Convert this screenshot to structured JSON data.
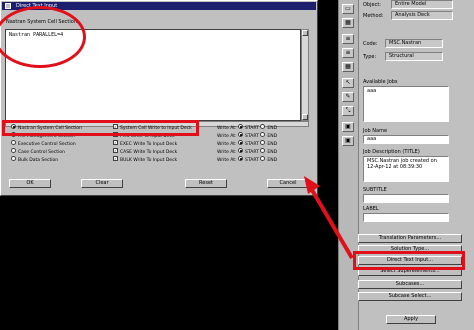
{
  "dialog": {
    "title": "Direct Text Input",
    "section_label": "Nastran System Cell Section",
    "text_content": "Nastran PARALLEL=4",
    "options_left": [
      {
        "label": "Nastran System Cell Section",
        "selected": true
      },
      {
        "label": "File Management Section",
        "selected": false
      },
      {
        "label": "Executive Control Section",
        "selected": false
      },
      {
        "label": "Case Control Section",
        "selected": false
      },
      {
        "label": "Bulk Data Section",
        "selected": false
      }
    ],
    "options_mid": [
      {
        "label": "System Cell Write to Input Deck",
        "checked": true
      },
      {
        "label": "FMS Write To Input Deck",
        "checked": true
      },
      {
        "label": "EXEC Write To Input Deck",
        "checked": true
      },
      {
        "label": "CASE Write To Input Deck",
        "checked": true
      },
      {
        "label": "BULK Write To Input Deck",
        "checked": true
      }
    ],
    "write_at_label": "Write At:",
    "start_label": "START",
    "end_label": "END",
    "buttons": {
      "ok": "OK",
      "clear": "Clear",
      "reset": "Reset",
      "cancel": "Cancel"
    }
  },
  "panel": {
    "object_label": "Object:",
    "object_value": "Entire Model",
    "method_label": "Method:",
    "method_value": "Analysis Deck",
    "code_label": "Code:",
    "code_value": "MSC.Nastran",
    "type_label": "Type:",
    "type_value": "Structural",
    "available_jobs_label": "Available Jobs",
    "available_jobs": [
      "aaa"
    ],
    "job_name_label": "Job Name",
    "job_name_value": "aaa",
    "job_desc_label": "Job Description (TITLE)",
    "job_desc_value": "MSC.Nastran job created on 12-Apr-12 at 08:39:30",
    "subtitle_label": "SUBTITLE",
    "label_label": "LABEL",
    "translation_button": "Translation Parameters...",
    "solution_button": "Solution Type...",
    "direct_text_button": "Direct Text Input...",
    "select_superelements_button": "Select Superelements...",
    "subcases_button": "Subcases...",
    "subcase_select_button": "Subcase Select...",
    "apply_button": "Apply"
  },
  "accent_red": "#e0101a"
}
